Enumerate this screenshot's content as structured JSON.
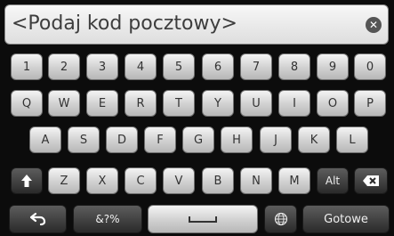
{
  "input": {
    "placeholder": "<Podaj kod pocztowy>"
  },
  "icons": {
    "clear": "close-icon",
    "shift": "shift-arrow-icon",
    "backspace": "backspace-icon",
    "back": "back-arrow-icon",
    "space": "space-bar-icon",
    "language": "globe-icon"
  },
  "keyboard": {
    "row1": [
      "1",
      "2",
      "3",
      "4",
      "5",
      "6",
      "7",
      "8",
      "9",
      "0"
    ],
    "row2": [
      "Q",
      "W",
      "E",
      "R",
      "T",
      "Y",
      "U",
      "I",
      "O",
      "P"
    ],
    "row3": [
      "A",
      "S",
      "D",
      "F",
      "G",
      "H",
      "J",
      "K",
      "L"
    ],
    "row4": [
      "Z",
      "X",
      "C",
      "V",
      "B",
      "N",
      "M"
    ],
    "alt_label": "Alt",
    "symbols_label": "&?%",
    "done_label": "Gotowe"
  }
}
